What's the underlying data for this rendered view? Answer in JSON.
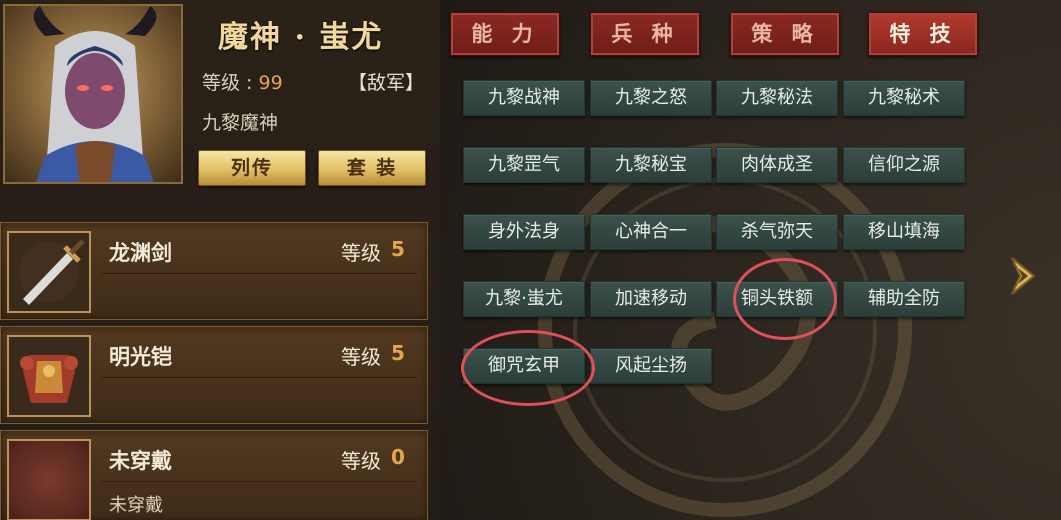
{
  "hero": {
    "name": "魔神 · 蚩尤",
    "level_label": "等级 : ",
    "level_value": "99",
    "faction": "【敌军】",
    "title": "九黎魔神",
    "buttons": {
      "biography": "列传",
      "set": "套 装"
    }
  },
  "equipment": [
    {
      "name": "龙渊剑",
      "level_label": "等级",
      "level": "5",
      "subtext": "",
      "icon": "sword-icon"
    },
    {
      "name": "明光铠",
      "level_label": "等级",
      "level": "5",
      "subtext": "",
      "icon": "armor-icon"
    },
    {
      "name": "未穿戴",
      "level_label": "等级",
      "level": "0",
      "subtext": "未穿戴",
      "icon": "empty-slot-icon"
    }
  ],
  "tabs": [
    {
      "label": "能 力",
      "active": false
    },
    {
      "label": "兵 种",
      "active": false
    },
    {
      "label": "策 略",
      "active": false
    },
    {
      "label": "特 技",
      "active": true
    }
  ],
  "skills": [
    "九黎战神",
    "九黎之怒",
    "九黎秘法",
    "九黎秘术",
    "九黎罡气",
    "九黎秘宝",
    "肉体成圣",
    "信仰之源",
    "身外法身",
    "心神合一",
    "杀气弥天",
    "移山填海",
    "九黎·蚩尤",
    "加速移动",
    "铜头铁额",
    "辅助全防",
    "御咒玄甲",
    "风起尘扬"
  ],
  "highlighted_skills": [
    "铜头铁额",
    "御咒玄甲"
  ],
  "colors": {
    "accent_gold": "#e2c064",
    "tab_red": "#8c2a22",
    "skill_teal": "#3c524c",
    "highlight_circle": "#e0505a",
    "level_orange": "#e6a64a"
  },
  "icons": {
    "next_arrow": "chevron-right-icon"
  }
}
